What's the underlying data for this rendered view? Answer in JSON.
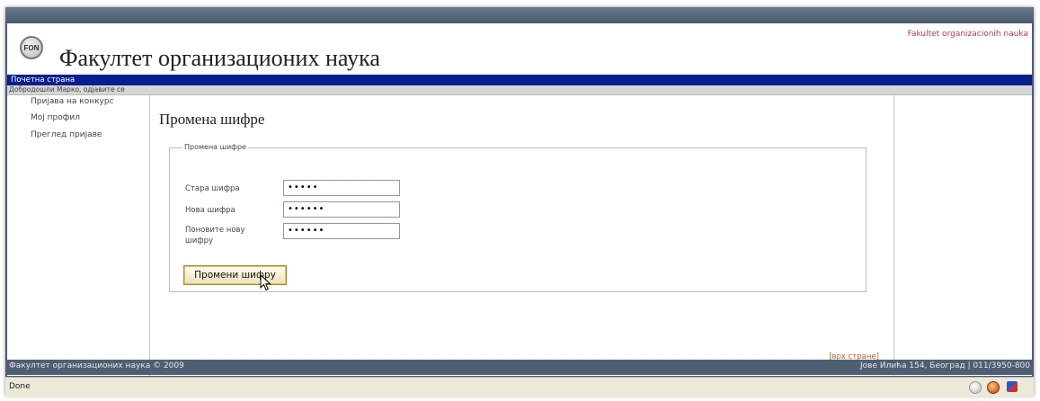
{
  "header": {
    "title": "Факултет организационих наука",
    "logo_text": "FON",
    "top_right_link": "Fakultet organizacionih nauka"
  },
  "nav": {
    "home": "Почетна страна"
  },
  "welcome": "Добродошли Марко, одјавите се",
  "sidebar": {
    "items": [
      {
        "label": "Пријава на конкурс"
      },
      {
        "label": "Мој профил"
      },
      {
        "label": "Преглед пријаве"
      }
    ]
  },
  "main": {
    "title": "Промена шифре",
    "fieldset_legend": "Промена шифре",
    "fields": [
      {
        "label": "Стара шифра",
        "value": "•••••"
      },
      {
        "label": "Нова шифра",
        "value": "••••••"
      },
      {
        "label": "Поновите нову шифру",
        "value": "••••••"
      }
    ],
    "submit_label": "Промени шифру",
    "top_link": "[врх стране]"
  },
  "footer": {
    "left": "Факултет организационих наука © 2009",
    "right": "Јове Илића 154, Београд | 011/3950-800"
  },
  "status": {
    "text": "Done"
  },
  "colors": {
    "nav_bg": "#0a1f8f",
    "footer_bg": "#4f5f73",
    "link_accent": "#c0602a"
  }
}
